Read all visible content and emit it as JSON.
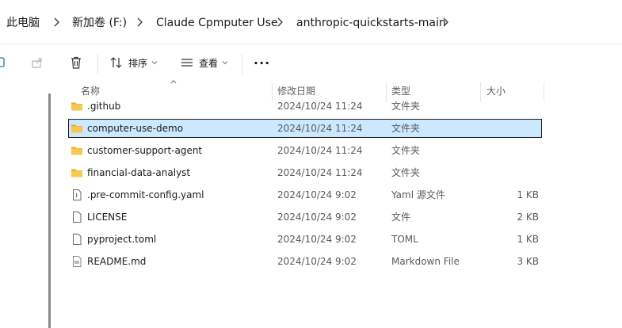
{
  "breadcrumb": {
    "items": [
      "此电脑",
      "新加卷 (F:)",
      "Claude Cpmputer Use",
      "anthropic-quickstarts-main"
    ]
  },
  "toolbar": {
    "sort_label": "排序",
    "view_label": "查看",
    "more_label": "···"
  },
  "columns": {
    "name": "名称",
    "modified": "修改日期",
    "type": "类型",
    "size": "大小"
  },
  "files": [
    {
      "name": ".github",
      "modified": "2024/10/24 11:24",
      "type": "文件夹",
      "size": "",
      "icon": "folder-icon"
    },
    {
      "name": "computer-use-demo",
      "modified": "2024/10/24 11:24",
      "type": "文件夹",
      "size": "",
      "icon": "folder-icon",
      "selected": true
    },
    {
      "name": "customer-support-agent",
      "modified": "2024/10/24 11:24",
      "type": "文件夹",
      "size": "",
      "icon": "folder-icon"
    },
    {
      "name": "financial-data-analyst",
      "modified": "2024/10/24 11:24",
      "type": "文件夹",
      "size": "",
      "icon": "folder-icon"
    },
    {
      "name": ".pre-commit-config.yaml",
      "modified": "2024/10/24 9:02",
      "type": "Yaml 源文件",
      "size": "1 KB",
      "icon": "yaml-file-icon"
    },
    {
      "name": "LICENSE",
      "modified": "2024/10/24 9:02",
      "type": "文件",
      "size": "2 KB",
      "icon": "file-icon"
    },
    {
      "name": "pyproject.toml",
      "modified": "2024/10/24 9:02",
      "type": "TOML",
      "size": "1 KB",
      "icon": "file-icon"
    },
    {
      "name": "README.md",
      "modified": "2024/10/24 9:02",
      "type": "Markdown File",
      "size": "3 KB",
      "icon": "markdown-file-icon"
    }
  ],
  "colors": {
    "folder": "#f4c04b",
    "selection_bg": "#cce8ff",
    "selection_border": "#1a1a1a"
  }
}
